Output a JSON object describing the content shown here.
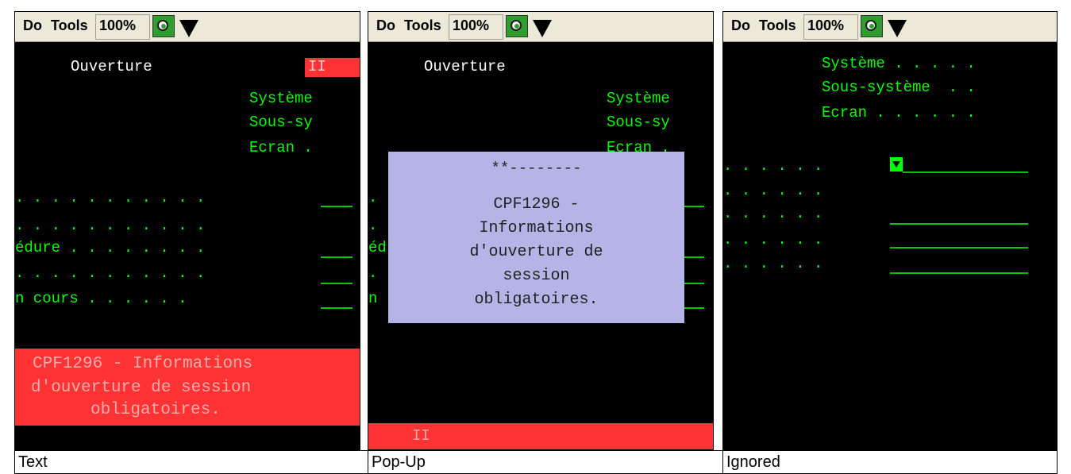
{
  "panels": [
    {
      "toolbar": {
        "do": "Do",
        "tools": "Tools",
        "zoom": "100%"
      },
      "screen": {
        "title": "Ouverture",
        "indicator": "II",
        "labels": [
          "Système",
          "Sous-sy",
          "Ecran ."
        ],
        "dots1": ". . . . . . . . . . .",
        "dots2": ". . . . . . . . . . .",
        "proc": "édure . . . . . . . .",
        "dots3": ". . . . . . . . . . .",
        "cours": "n cours . . . . . .",
        "message": [
          "CPF1296 - Informations",
          "d'ouverture de session",
          "obligatoires."
        ]
      },
      "caption": "Text"
    },
    {
      "toolbar": {
        "do": "Do",
        "tools": "Tools",
        "zoom": "100%"
      },
      "screen": {
        "title": "Ouverture",
        "labels": [
          "Système",
          "Sous-sy",
          "Ecran ."
        ],
        "bg_left": [
          ".",
          ".",
          "éd",
          ".",
          "n"
        ],
        "popup_head": "**--------",
        "popup_lines": [
          "CPF1296 -",
          "Informations",
          "d'ouverture de",
          "session",
          "obligatoires."
        ],
        "indicator": "II"
      },
      "caption": "Pop-Up"
    },
    {
      "toolbar": {
        "do": "Do",
        "tools": "Tools",
        "zoom": "100%"
      },
      "screen": {
        "labels": [
          "Système . . . . .",
          "Sous-système  . .",
          "Ecran . . . . . ."
        ],
        "dots": [
          ". . . . . .",
          ". . . . . .",
          ". . . . . .",
          ". . . . . .",
          ". . . . . ."
        ]
      },
      "caption": "Ignored"
    }
  ]
}
